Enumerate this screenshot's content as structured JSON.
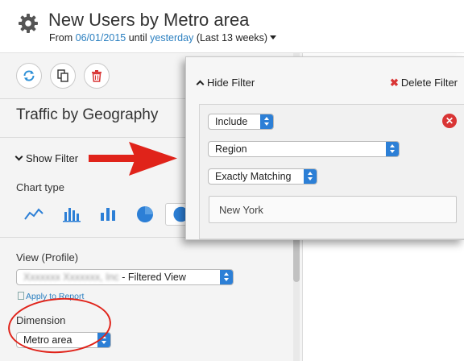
{
  "header": {
    "title": "New Users by Metro area",
    "from_prefix": "From",
    "start_date": "06/01/2015",
    "until": "until",
    "end_date": "yesterday",
    "range_note": "(Last 13 weeks)"
  },
  "panel": {
    "section_title": "Traffic by Geography",
    "show_filter": "Show Filter",
    "chart_type_label": "Chart type",
    "chart_types": [
      "line-chart-icon",
      "bar-chart-icon",
      "column-chart-icon",
      "pie-chart-icon",
      "geo-map-icon"
    ],
    "view_label": "View (Profile)",
    "view_value_blurred": "Xxxxxxx Xxxxxxx, Inc",
    "view_value_suffix": " - Filtered View",
    "apply_link": "Apply to Report",
    "dimension_label": "Dimension",
    "dimension_value": "Metro area"
  },
  "filter": {
    "hide_label": "Hide Filter",
    "delete_label": "Delete Filter",
    "mode": "Include",
    "field": "Region",
    "match_type": "Exactly Matching",
    "value": "New York"
  },
  "colors": {
    "accent_blue": "#2c7fd6",
    "link": "#2a7fc0",
    "annotation_red": "#e0231a",
    "delete_red": "#d93535"
  }
}
